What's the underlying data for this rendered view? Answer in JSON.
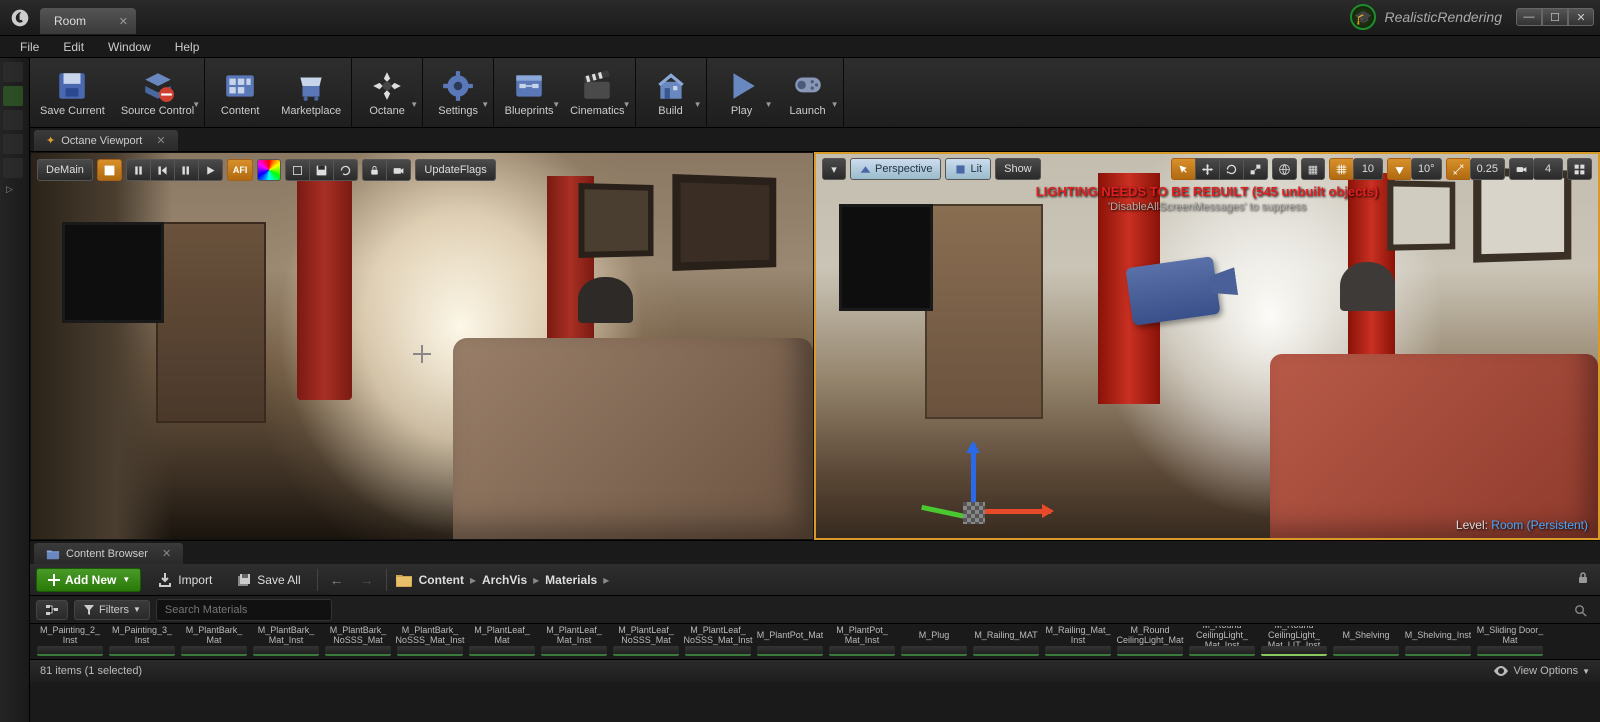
{
  "window": {
    "tab_title": "Room",
    "project_name": "RealisticRendering"
  },
  "menu": {
    "file": "File",
    "edit": "Edit",
    "window": "Window",
    "help": "Help"
  },
  "toolbar": {
    "save": "Save Current",
    "source_control": "Source Control",
    "content": "Content",
    "marketplace": "Marketplace",
    "octane": "Octane",
    "settings": "Settings",
    "blueprints": "Blueprints",
    "cinematics": "Cinematics",
    "build": "Build",
    "play": "Play",
    "launch": "Launch"
  },
  "left_viewport": {
    "tab_title": "Octane Viewport",
    "demain": "DeMain",
    "update_flags": "UpdateFlags"
  },
  "right_viewport": {
    "perspective": "Perspective",
    "lit": "Lit",
    "show": "Show",
    "snap_pos": "10",
    "snap_rot": "10°",
    "snap_scale": "0.25",
    "cam_speed": "4",
    "warn_line1": "LIGHTING NEEDS TO BE REBUILT (545 unbuilt objects)",
    "warn_line2": "'DisableAllScreenMessages' to suppress",
    "level_label": "Level:",
    "level_value": "Room (Persistent)"
  },
  "content_browser": {
    "tab_title": "Content Browser",
    "add_new": "Add New",
    "import": "Import",
    "save_all": "Save All",
    "filters": "Filters",
    "search_placeholder": "Search Materials",
    "path": {
      "root": "Content",
      "sub1": "ArchVis",
      "sub2": "Materials"
    },
    "status": "81 items (1 selected)",
    "view_options": "View Options",
    "assets": [
      "M_Painting_2_Inst",
      "M_Painting_3_Inst",
      "M_PlantBark_Mat",
      "M_PlantBark_Mat_Inst",
      "M_PlantBark_NoSSS_Mat",
      "M_PlantBark_NoSSS_Mat_Inst",
      "M_PlantLeaf_Mat",
      "M_PlantLeaf_Mat_Inst",
      "M_PlantLeaf_NoSSS_Mat",
      "M_PlantLeaf_NoSSS_Mat_Inst",
      "M_PlantPot_Mat",
      "M_PlantPot_Mat_Inst",
      "M_Plug",
      "M_Railing_MAT",
      "M_Railing_Mat_Inst",
      "M_Round CeilingLight_Mat",
      "M_Round CeilingLight_Mat_Inst",
      "M_Round CeilingLight_Mat_LIT_Inst",
      "M_Shelving",
      "M_Shelving_Inst",
      "M_Sliding Door_Mat"
    ]
  }
}
